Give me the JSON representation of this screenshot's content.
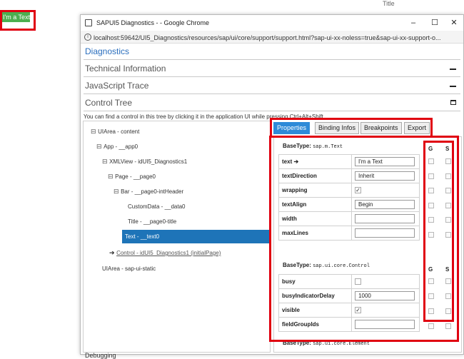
{
  "app": {
    "element_text": "I'm a Text",
    "top_title": "Title"
  },
  "window": {
    "title": "SAPUI5 Diagnostics - - Google Chrome",
    "controls": [
      "–",
      "☐",
      "✕"
    ],
    "url": "localhost:59642/UI5_Diagnostics/resources/sap/ui/core/support/support.html?sap-ui-xx-noless=true&sap-ui-xx-support-o..."
  },
  "diagnostics": {
    "header": "Diagnostics",
    "sections": [
      "Technical Information",
      "JavaScript Trace",
      "Control Tree"
    ],
    "hint": "You can find a control in this tree by clicking it in the application UI while pressing Ctrl+Alt+Shift."
  },
  "tree": [
    {
      "toggle": "⊟",
      "label": "UIArea - content"
    },
    {
      "toggle": "⊟",
      "label": "App - __app0"
    },
    {
      "toggle": "⊟",
      "label": "XMLView - idUI5_Diagnostics1"
    },
    {
      "toggle": "⊟",
      "label": "Page - __page0"
    },
    {
      "toggle": "⊟",
      "label": "Bar - __page0-intHeader"
    },
    {
      "toggle": "",
      "label": "CustomData - __data0"
    },
    {
      "toggle": "",
      "label": "Title - __page0-title"
    },
    {
      "toggle": "",
      "label": "Text - __text0",
      "selected": true
    },
    {
      "toggle": "➔",
      "label": "Control - idUI5_Diagnostics1 (initialPage)"
    },
    {
      "toggle": "",
      "label": "UIArea - sap-ui-static"
    }
  ],
  "tabs": [
    "Properties",
    "Binding Infos",
    "Breakpoints",
    "Export"
  ],
  "groups": [
    {
      "base_label": "BaseType:",
      "base_type": "sap.m.Text",
      "g": "G",
      "s": "S",
      "props": [
        {
          "name": "text ➔",
          "kind": "input",
          "value": "I'm a Text"
        },
        {
          "name": "textDirection",
          "kind": "input",
          "value": "Inherit"
        },
        {
          "name": "wrapping",
          "kind": "checkbox",
          "checked": true
        },
        {
          "name": "textAlign",
          "kind": "input",
          "value": "Begin"
        },
        {
          "name": "width",
          "kind": "input",
          "value": ""
        },
        {
          "name": "maxLines",
          "kind": "input",
          "value": ""
        }
      ]
    },
    {
      "base_label": "BaseType:",
      "base_type": "sap.ui.core.Control",
      "g": "G",
      "s": "S",
      "props": [
        {
          "name": "busy",
          "kind": "checkbox",
          "checked": false
        },
        {
          "name": "busyIndicatorDelay",
          "kind": "input",
          "value": "1000"
        },
        {
          "name": "visible",
          "kind": "checkbox",
          "checked": true
        },
        {
          "name": "fieldGroupIds",
          "kind": "input",
          "value": ""
        }
      ]
    },
    {
      "base_label": "BaseType:",
      "base_type": "sap.ui.core.Element"
    }
  ],
  "bottom_text": "Debugging",
  "colors": {
    "highlight": "#e00010",
    "selection": "#1e74b8",
    "active_tab": "#2e8ad8",
    "green_text": "#4caf50"
  }
}
